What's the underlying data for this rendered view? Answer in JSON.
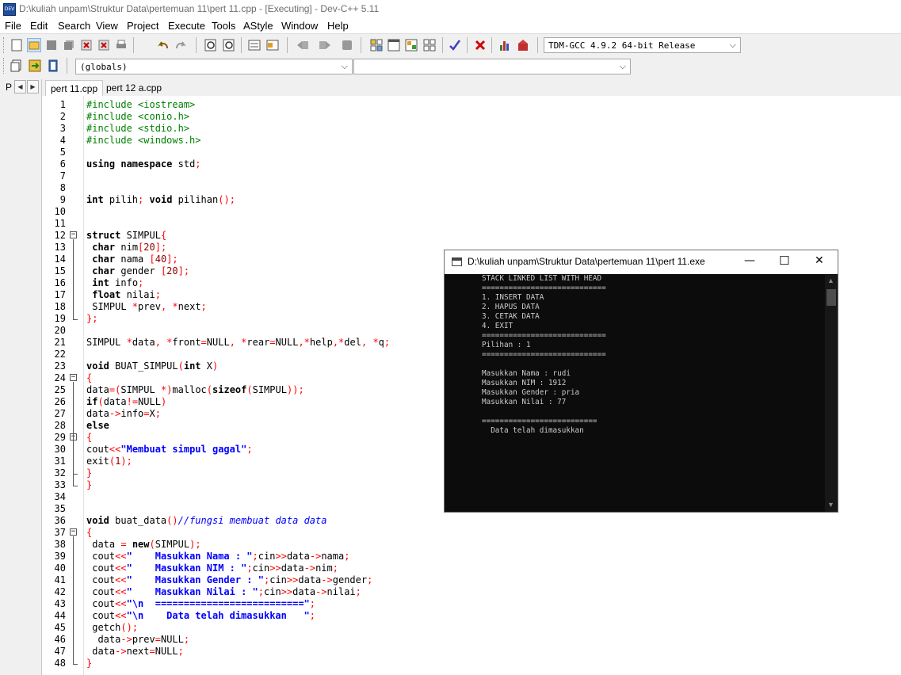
{
  "window": {
    "title": "D:\\kuliah unpam\\Struktur Data\\pertemuan 11\\pert 11.cpp - [Executing] - Dev-C++ 5.11",
    "app_icon": "DEV"
  },
  "menu": [
    "File",
    "Edit",
    "Search",
    "View",
    "Project",
    "Execute",
    "Tools",
    "AStyle",
    "Window",
    "Help"
  ],
  "toolbar": {
    "compiler_select": "TDM-GCC 4.9.2 64-bit Release",
    "scope_select": "(globals)",
    "symbol_select": ""
  },
  "left_panel": {
    "label": "P"
  },
  "tabs": [
    {
      "label": "pert 11.cpp",
      "active": true
    },
    {
      "label": "pert 12 a.cpp",
      "active": false
    }
  ],
  "code_lines": [
    "#include <iostream>",
    "#include <conio.h>",
    "#include <stdio.h>",
    "#include <windows.h>",
    "",
    "using namespace std;",
    "",
    "",
    "int pilih; void pilihan();",
    "",
    "",
    "struct SIMPUL{",
    " char nim[20];",
    " char nama [40];",
    " char gender [20];",
    " int info;",
    " float nilai;",
    " SIMPUL *prev, *next;",
    "};",
    "",
    "SIMPUL *data, *front=NULL, *rear=NULL,*help,*del, *q;",
    "",
    "void BUAT_SIMPUL(int X)",
    "{",
    "data=(SIMPUL *)malloc(sizeof(SIMPUL));",
    "if(data!=NULL)",
    "data->info=X;",
    "else",
    "{",
    "cout<<\"Membuat simpul gagal\";",
    "exit(1);",
    "}",
    "}",
    "",
    "",
    "void buat_data()//fungsi membuat data data",
    "{",
    " data = new(SIMPUL);",
    " cout<<\"    Masukkan Nama : \";cin>>data->nama;",
    " cout<<\"    Masukkan NIM : \";cin>>data->nim;",
    " cout<<\"    Masukkan Gender : \";cin>>data->gender;",
    " cout<<\"    Masukkan Nilai : \";cin>>data->nilai;",
    " cout<<\"\\n  ==========================\";",
    " cout<<\"\\n    Data telah dimasukkan   \";",
    " getch();",
    "  data->prev=NULL;",
    " data->next=NULL;",
    "}"
  ],
  "console": {
    "title": "D:\\kuliah unpam\\Struktur Data\\pertemuan 11\\pert 11.exe",
    "lines": [
      "STACK LINKED LIST WITH HEAD",
      "============================",
      "1. INSERT DATA",
      "2. HAPUS DATA",
      "3. CETAK DATA",
      "4. EXIT",
      "============================",
      "Pilihan : 1",
      "============================",
      "",
      "Masukkan Nama : rudi",
      "Masukkan NIM : 1912",
      "Masukkan Gender : pria",
      "Masukkan Nilai : 77",
      "",
      "==========================",
      "  Data telah dimasukkan"
    ],
    "minimize": "—",
    "maximize": "☐",
    "close": "✕"
  },
  "colors": {
    "keyword": "#000000",
    "preprocessor": "#008000",
    "number": "#8b0000",
    "symbol": "#ff0000",
    "string": "#0000ff",
    "comment": "#0000ff",
    "console_bg": "#0c0c0c",
    "console_fg": "#cccccc"
  }
}
